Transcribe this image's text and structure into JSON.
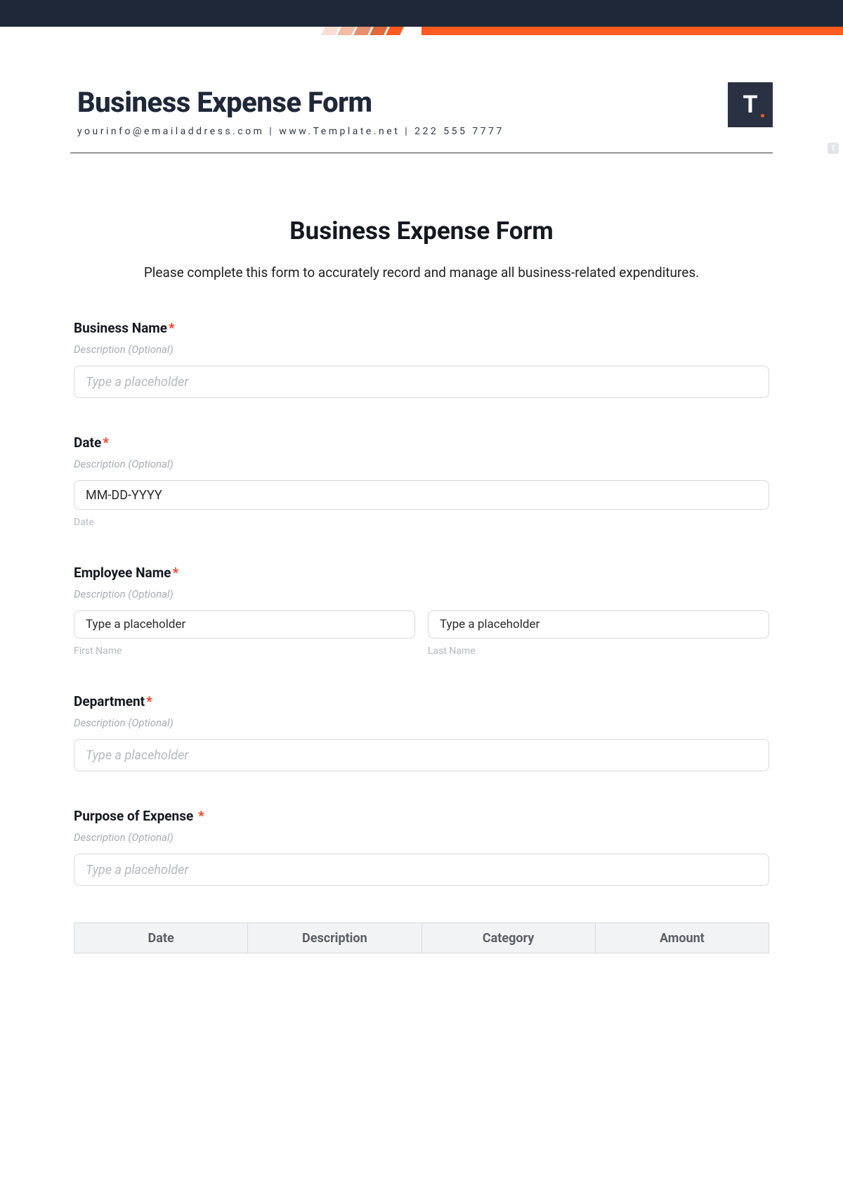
{
  "header": {
    "title": "Business Expense Form",
    "contact": "yourinfo@emailaddress.com | www.Template.net | 222 555 7777",
    "brand_letter": "T"
  },
  "form": {
    "title": "Business Expense Form",
    "intro": "Please complete this form to accurately record and manage all business-related expenditures.",
    "fields": {
      "business_name": {
        "label": "Business Name",
        "desc": "Description (Optional)",
        "placeholder": "Type a placeholder"
      },
      "date": {
        "label": "Date",
        "desc": "Description (Optional)",
        "placeholder": "MM-DD-YYYY",
        "subhint": "Date"
      },
      "employee_name": {
        "label": "Employee Name",
        "desc": "Description (Optional)",
        "first_placeholder": "Type a placeholder",
        "last_placeholder": "Type a placeholder",
        "first_hint": "First Name",
        "last_hint": "Last Name"
      },
      "department": {
        "label": "Department",
        "desc": "Description (Optional)",
        "placeholder": "Type a placeholder"
      },
      "purpose": {
        "label": "Purpose of Expense",
        "desc": "Description (Optional)",
        "placeholder": "Type a placeholder"
      }
    },
    "table": {
      "headers": [
        "Date",
        "Description",
        "Category",
        "Amount"
      ]
    }
  },
  "side_badge": "T"
}
